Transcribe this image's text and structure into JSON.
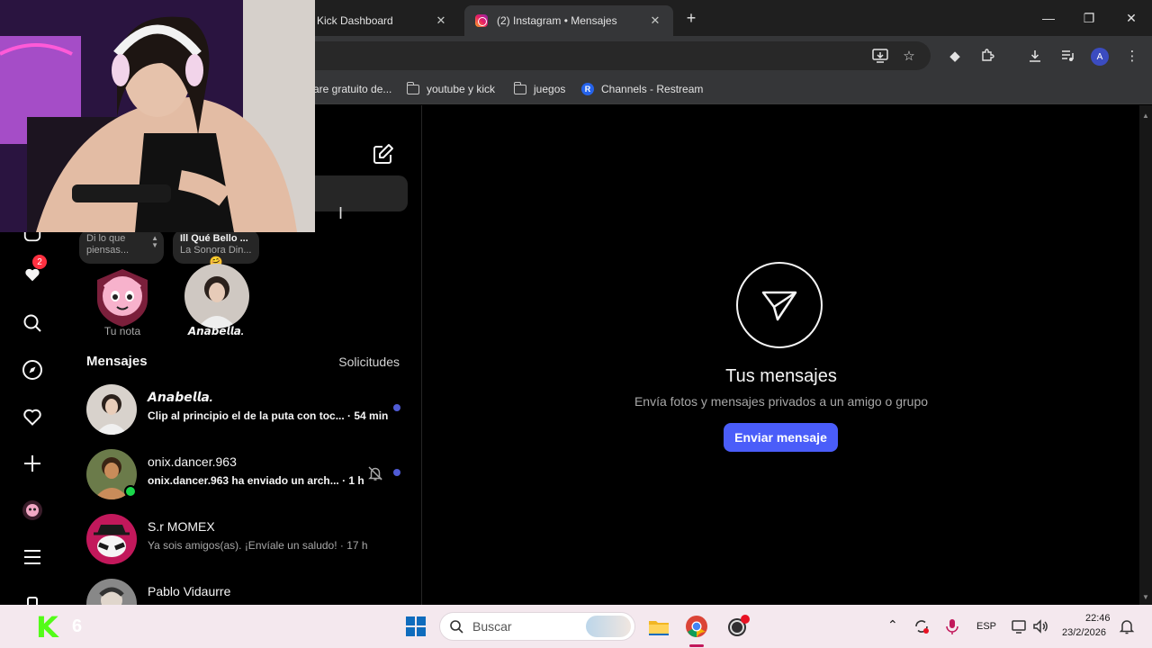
{
  "browser": {
    "tabs": [
      {
        "label": "Kick Dashboard",
        "active": false
      },
      {
        "label": "(2) Instagram • Mensajes",
        "active": true
      }
    ],
    "bookmarks": [
      {
        "label": "are gratuito de...",
        "icon": "folder-icon"
      },
      {
        "label": "youtube y kick",
        "icon": "folder-icon"
      },
      {
        "label": "juegos",
        "icon": "folder-icon"
      },
      {
        "label": "Channels - Restream",
        "icon": "restream-icon"
      }
    ],
    "profile_initial": "A"
  },
  "rail": {
    "notifications_badge": "2"
  },
  "notes": [
    {
      "bubble_line1": "Di lo que",
      "bubble_line2": "piensas...",
      "caption": "Tu nota"
    },
    {
      "bubble_line1": "Ill Qué Bello ...",
      "bubble_line2": "La Sonora Din...",
      "bubble_emoji": "🤗",
      "caption": "𝘼𝙣𝙖𝙗𝙚𝙡𝙡𝙖."
    }
  ],
  "inbox": {
    "header": "Mensajes",
    "requests": "Solicitudes",
    "threads": [
      {
        "name": "𝘼𝙣𝙖𝙗𝙚𝙡𝙡𝙖.",
        "preview": "Clip al principio el de la puta con toc... · 54 min",
        "unread": true,
        "online": false,
        "muted": false
      },
      {
        "name": "onix.dancer.963",
        "preview": "onix.dancer.963 ha enviado un arch... · 1 h",
        "unread": true,
        "online": true,
        "muted": true
      },
      {
        "name": "S.r MOMEX",
        "preview": "Ya sois amigos(as). ¡Envíale un saludo! · 17 h",
        "unread": false,
        "online": false,
        "muted": false
      },
      {
        "name": "Pablo Vidaurre",
        "preview": "",
        "unread": false,
        "online": false,
        "muted": false
      }
    ]
  },
  "empty_state": {
    "title": "Tus mensajes",
    "subtitle": "Envía fotos y mensajes privados a un amigo o grupo",
    "button": "Enviar mensaje"
  },
  "taskbar": {
    "search_placeholder": "Buscar",
    "language": "ESP",
    "time": "22:46",
    "date": "23/2/2026",
    "kick_counter": "6"
  },
  "colors": {
    "accent": "#4a5df9",
    "unread_dot": "#4f5bd5",
    "badge": "#ff3040",
    "online": "#1ad84b",
    "kick_green": "#53fc18"
  }
}
